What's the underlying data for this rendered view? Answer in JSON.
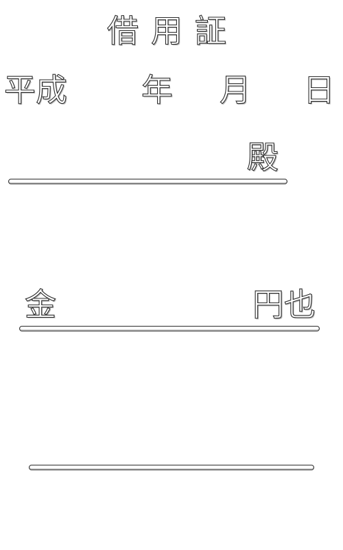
{
  "document": {
    "title": "借用証"
  },
  "date": {
    "era": "平成",
    "year_unit": "年",
    "month_unit": "月",
    "day_unit": "日"
  },
  "addressee": {
    "suffix": "殿"
  },
  "amount": {
    "prefix": "金",
    "suffix": "円也"
  }
}
